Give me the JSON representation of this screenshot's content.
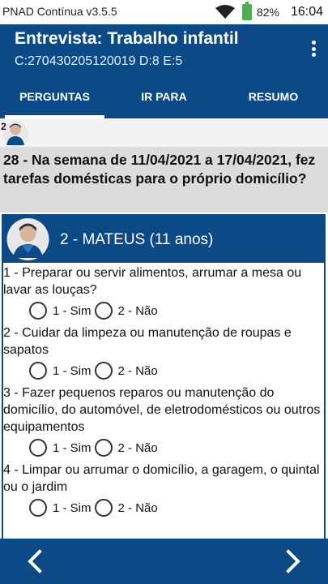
{
  "status": {
    "app_name": "PNAD Contínua v3.5.5",
    "battery": "82%",
    "time": "16:04",
    "icons": [
      "wifi-icon",
      "battery-icon"
    ]
  },
  "appbar": {
    "title": "Entrevista: Trabalho infantil",
    "subtitle": "C:270430205120019 D:8 E:5",
    "menu_icon": "more-vert-icon"
  },
  "tabs": [
    {
      "label": "PERGUNTAS",
      "active": true
    },
    {
      "label": "IR PARA",
      "active": false
    },
    {
      "label": "RESUMO",
      "active": false
    }
  ],
  "mini_avatar": {
    "number": "2"
  },
  "question": {
    "text": "28 - Na semana de 11/04/2021 a 17/04/2021, fez tarefas domésticas para o próprio domicílio?"
  },
  "person": {
    "name": "2 - MATEUS (11 anos)"
  },
  "items": [
    {
      "text": "1 - Preparar ou servir alimentos, arrumar a mesa ou lavar as louças?",
      "opt_yes": "1 - Sim",
      "opt_no": "2 - Não"
    },
    {
      "text": "2 - Cuidar da limpeza ou manutenção de roupas e sapatos",
      "opt_yes": "1 - Sim",
      "opt_no": "2 - Não"
    },
    {
      "text": "3 - Fazer pequenos reparos ou manutenção do domicílio, do automóvel, de eletrodomésticos ou outros equipamentos",
      "opt_yes": "1 - Sim",
      "opt_no": "2 - Não"
    },
    {
      "text": "4 - Limpar ou arrumar o domicílio, a garagem, o quintal ou o jardim",
      "opt_yes": "1 - Sim",
      "opt_no": "2 - Não"
    }
  ],
  "colors": {
    "primary": "#0b4a86",
    "question_bg": "#dcdcdc",
    "battery": "#4caf50"
  },
  "nav": {
    "prev_icon": "chevron-left-icon",
    "next_icon": "chevron-right-icon"
  }
}
